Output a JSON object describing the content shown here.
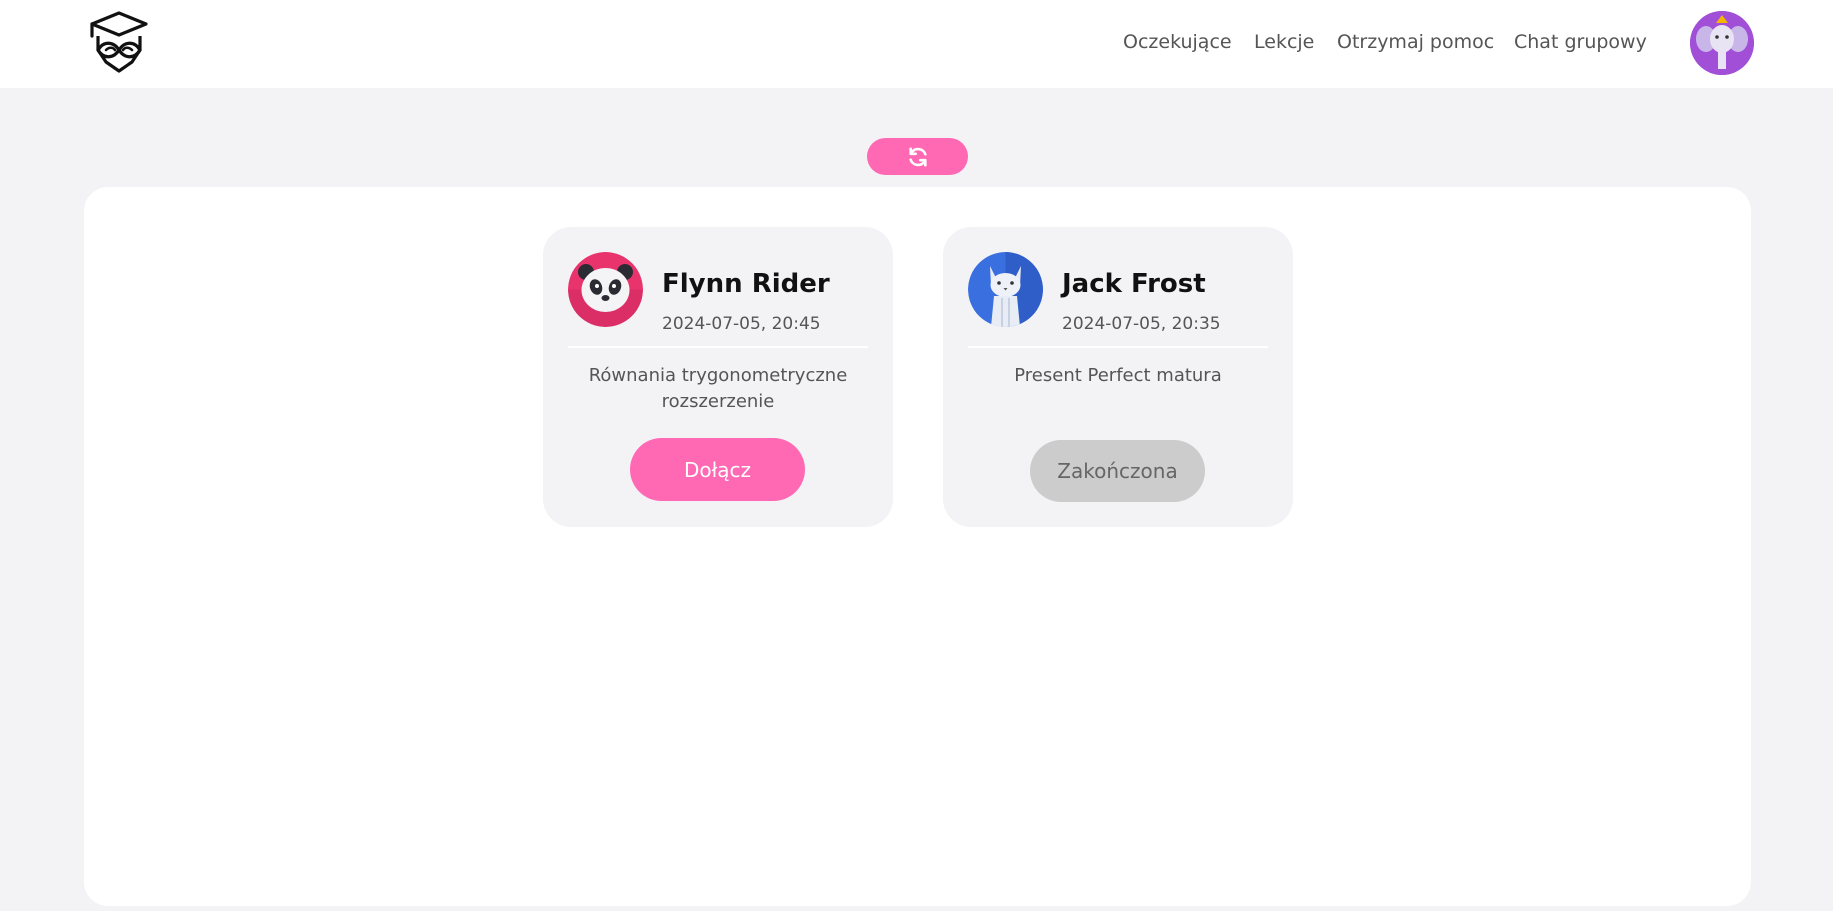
{
  "header": {
    "logo_icon": "graduation-cap-owl-icon",
    "nav": [
      {
        "label": "Oczekujące"
      },
      {
        "label": "Lekcje"
      },
      {
        "label": "Otrzymaj pomoc"
      },
      {
        "label": "Chat grupowy"
      }
    ],
    "user_avatar_icon": "elephant-avatar-icon"
  },
  "toolbar": {
    "refresh_icon": "refresh-icon",
    "accent_color": "#ff69b4"
  },
  "lessons": [
    {
      "avatar_icon": "panda-avatar-icon",
      "avatar_color": "#e8336d",
      "name": "Flynn Rider",
      "datetime": "2024-07-05, 20:45",
      "topic": "Równania trygonometryczne rozszerzenie",
      "action_label": "Dołącz",
      "action_state": "active"
    },
    {
      "avatar_icon": "cat-avatar-icon",
      "avatar_color": "#3a6fe0",
      "name": "Jack Frost",
      "datetime": "2024-07-05, 20:35",
      "topic": "Present Perfect matura",
      "action_label": "Zakończona",
      "action_state": "finished"
    }
  ]
}
